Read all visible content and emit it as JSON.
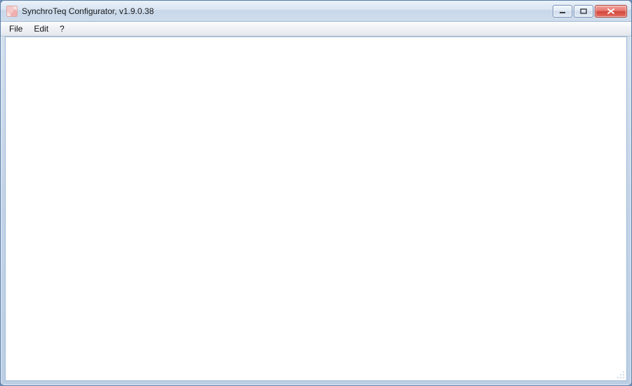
{
  "window": {
    "title": "SynchroTeq Configurator, v1.9.0.38"
  },
  "menu": {
    "items": [
      {
        "label": "File"
      },
      {
        "label": "Edit"
      },
      {
        "label": "?"
      }
    ]
  }
}
